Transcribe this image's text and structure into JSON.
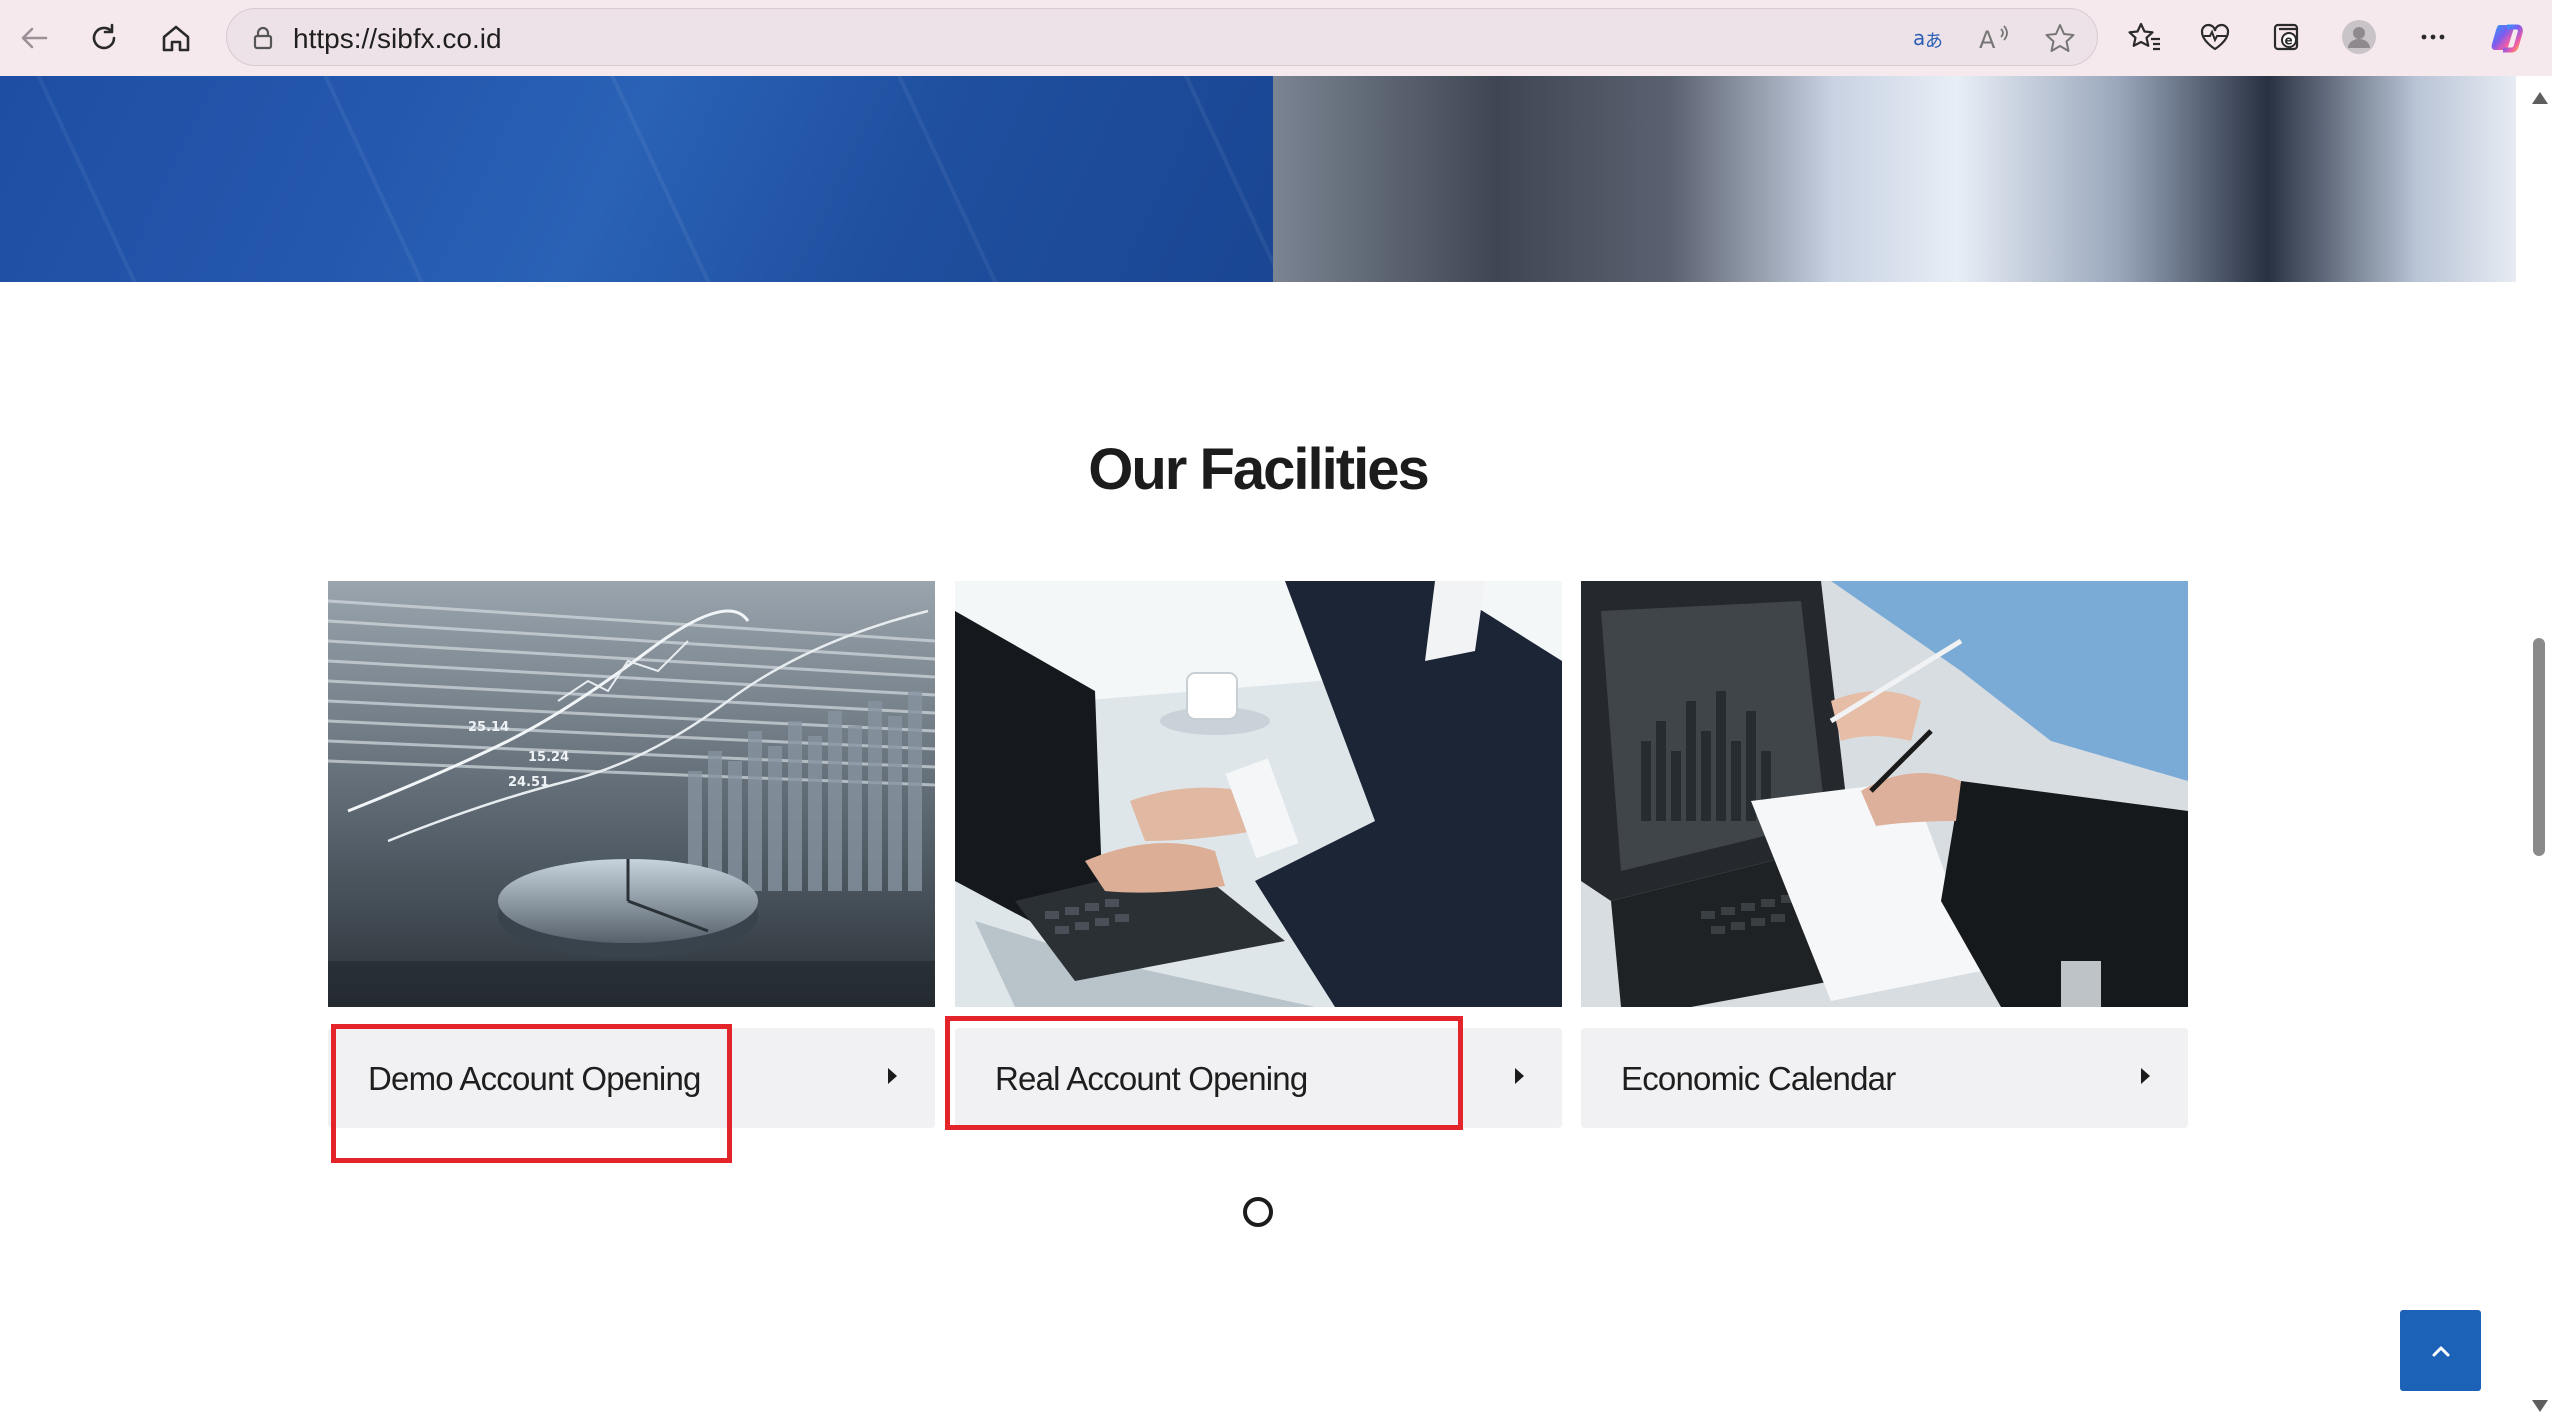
{
  "browser": {
    "url": "https://sibfx.co.id",
    "icons": {
      "back": "back-arrow-icon",
      "refresh": "refresh-icon",
      "home": "home-icon",
      "lock": "site-info-lock-icon",
      "translate": "translate-icon",
      "read_aloud": "read-aloud-icon",
      "favorite": "add-favorite-star-icon",
      "favorites": "favorites-list-icon",
      "health": "browser-essentials-icon",
      "collections": "collections-icon",
      "profile": "profile-avatar-icon",
      "more": "more-options-icon",
      "copilot": "copilot-icon"
    }
  },
  "page": {
    "section_title": "Our Facilities",
    "cards": [
      {
        "label": "Demo Account Opening"
      },
      {
        "label": "Real Account Opening"
      },
      {
        "label": "Economic Calendar"
      }
    ],
    "colors": {
      "highlight": "#e3242b",
      "accent_blue": "#1c63b8",
      "card_bar": "#f1f1f3"
    }
  }
}
